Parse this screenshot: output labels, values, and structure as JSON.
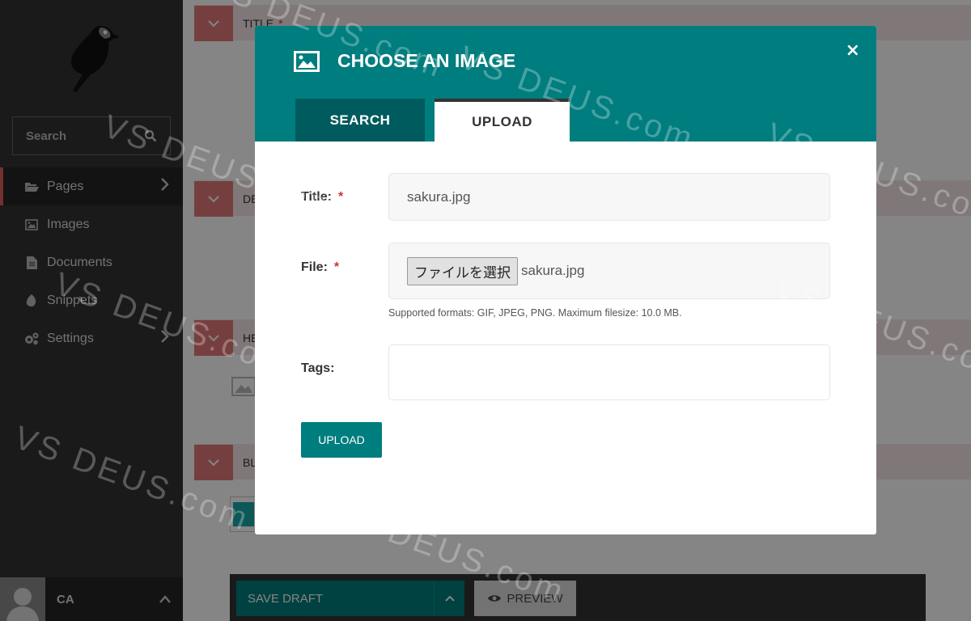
{
  "sidebar": {
    "search_placeholder": "Search",
    "items": [
      {
        "label": "Pages",
        "icon": "folder-open-icon",
        "active": true,
        "has_submenu": true
      },
      {
        "label": "Images",
        "icon": "image-icon",
        "active": false,
        "has_submenu": false
      },
      {
        "label": "Documents",
        "icon": "document-icon",
        "active": false,
        "has_submenu": false
      },
      {
        "label": "Snippets",
        "icon": "snippet-icon",
        "active": false,
        "has_submenu": false
      },
      {
        "label": "Settings",
        "icon": "cogs-icon",
        "active": false,
        "has_submenu": true
      }
    ],
    "account_initials": "CA"
  },
  "background_page": {
    "fields": [
      {
        "label": "TITLE",
        "required": "*"
      },
      {
        "label": "DESC"
      },
      {
        "label": "HEA"
      },
      {
        "label": "BLO"
      }
    ],
    "footer": {
      "save_draft": "SAVE DRAFT",
      "preview": "PREVIEW"
    }
  },
  "modal": {
    "title": "CHOOSE AN IMAGE",
    "close": "×",
    "tabs": [
      {
        "label": "SEARCH",
        "active": false
      },
      {
        "label": "UPLOAD",
        "active": true
      }
    ],
    "form": {
      "title_label": "Title:",
      "title_value": "sakura.jpg",
      "file_label": "File:",
      "file_button": "ファイルを選択",
      "file_name": "sakura.jpg",
      "help_text": "Supported formats: GIF, JPEG, PNG. Maximum filesize: 10.0 MB.",
      "tags_label": "Tags:",
      "tags_value": "",
      "required_mark": "*",
      "submit": "UPLOAD"
    }
  },
  "watermark": "VS DEUS.com",
  "colors": {
    "teal": "#007d7e",
    "teal_dark": "#005b5e",
    "sidebar": "#333333",
    "required": "#cd3238"
  }
}
